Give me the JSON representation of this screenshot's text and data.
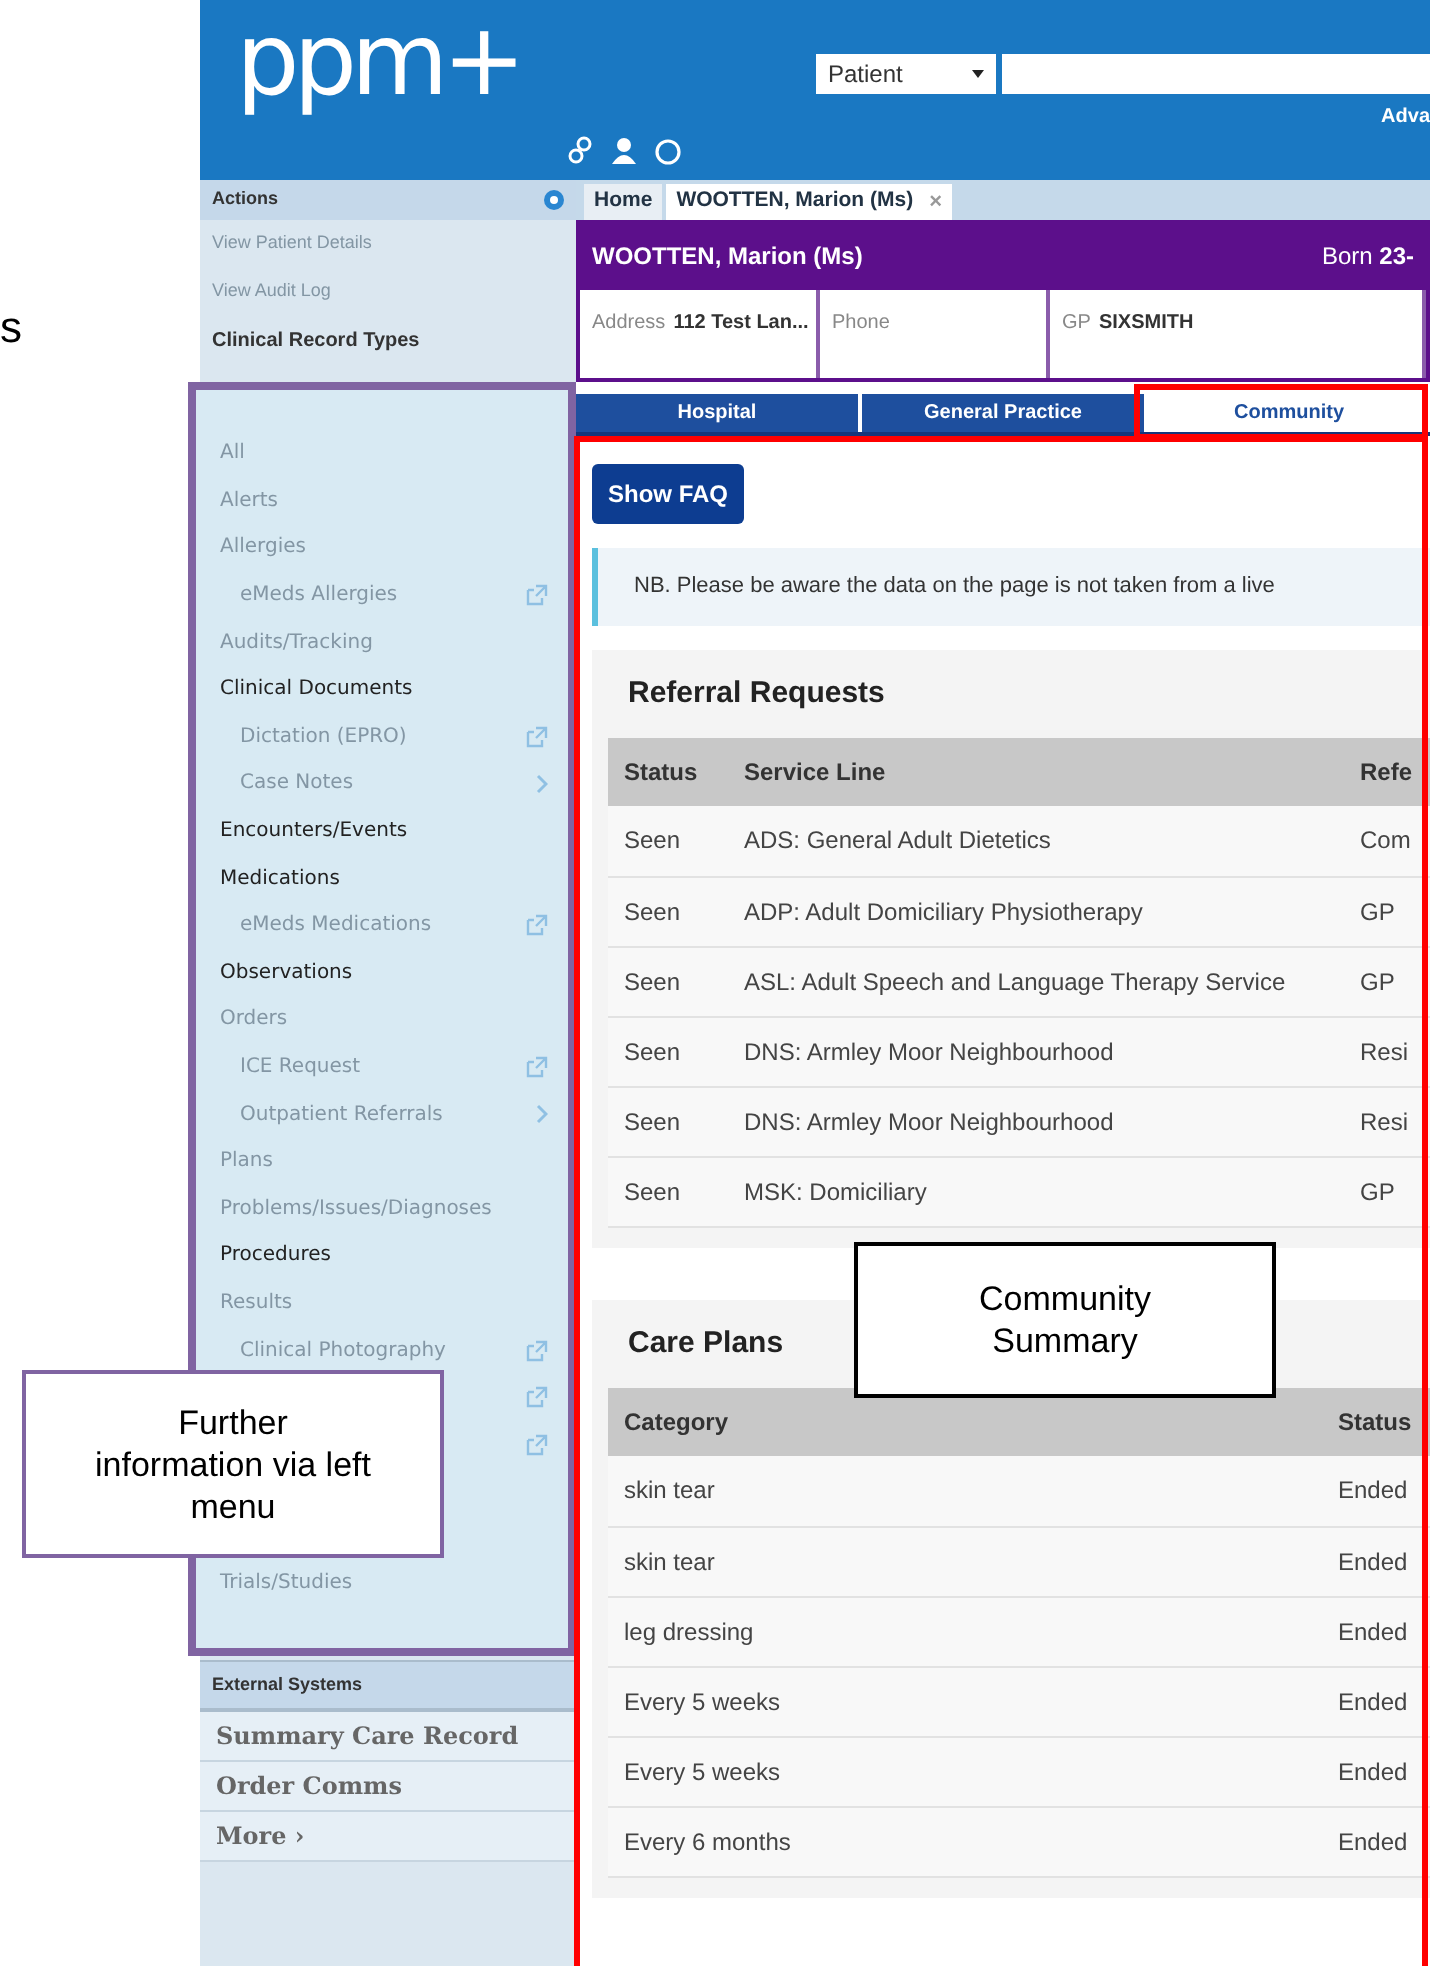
{
  "header": {
    "logo": "ppm+",
    "search_scope": "Patient",
    "advanced_link": "Adva"
  },
  "sidebar": {
    "actions_title": "Actions",
    "actions": [
      {
        "label": "View Patient Details",
        "disabled": true
      },
      {
        "label": "View Audit Log",
        "disabled": true
      }
    ],
    "section_title": "Clinical Record Types",
    "record_types": [
      {
        "label": "All",
        "disabled": true
      },
      {
        "label": "Alerts",
        "disabled": true
      },
      {
        "label": "Allergies",
        "disabled": true,
        "children": [
          {
            "label": "eMeds Allergies",
            "disabled": true,
            "external_link": true
          }
        ]
      },
      {
        "label": "Audits/Tracking",
        "disabled": true
      },
      {
        "label": "Clinical Documents",
        "disabled": false,
        "children": [
          {
            "label": "Dictation (EPRO)",
            "disabled": true,
            "external_link": true
          },
          {
            "label": "Case Notes",
            "disabled": true,
            "submenu": true
          }
        ]
      },
      {
        "label": "Encounters/Events",
        "disabled": false
      },
      {
        "label": "Medications",
        "disabled": false,
        "children": [
          {
            "label": "eMeds Medications",
            "disabled": true,
            "external_link": true
          }
        ]
      },
      {
        "label": "Observations",
        "disabled": false
      },
      {
        "label": "Orders",
        "disabled": true,
        "children": [
          {
            "label": "ICE Request",
            "disabled": true,
            "external_link": true
          },
          {
            "label": "Outpatient Referrals",
            "disabled": true,
            "submenu": true
          }
        ]
      },
      {
        "label": "Plans",
        "disabled": true
      },
      {
        "label": "Problems/Issues/Diagnoses",
        "disabled": true
      },
      {
        "label": "Procedures",
        "disabled": false
      },
      {
        "label": "Results",
        "disabled": true,
        "children": [
          {
            "label": "Clinical Photography",
            "disabled": true,
            "external_link": true
          },
          {
            "external_link": true
          },
          {
            "external_link": true
          }
        ]
      },
      {
        "label": "Trials/Studies",
        "disabled": true
      }
    ],
    "external_title": "External Systems",
    "external": [
      {
        "label": "Summary Care Record"
      },
      {
        "label": "Order Comms"
      },
      {
        "label": "More",
        "suffix": "›"
      }
    ]
  },
  "tabs": [
    {
      "label": "Home",
      "selected": false
    },
    {
      "label": "WOOTTEN, Marion (Ms)",
      "selected": true,
      "close": "×"
    }
  ],
  "banner": {
    "name": "WOOTTEN, Marion (Ms)",
    "born_label": "Born",
    "born_value": "23-"
  },
  "patient_info": [
    {
      "label": "Address",
      "value": "112 Test Lan..."
    },
    {
      "label": "Phone"
    },
    {
      "label": "GP",
      "value": "SIXSMITH"
    }
  ],
  "view_tabs": [
    {
      "label": "Hospital",
      "selected": false
    },
    {
      "label": "General Practice",
      "selected": false
    },
    {
      "label": "Community",
      "selected": true
    }
  ],
  "faq_button": "Show FAQ",
  "notice": "NB. Please be aware the data on the page is not taken from a live",
  "panels": [
    {
      "title": "Referral Requests",
      "columns": [
        "Status",
        "Service Line",
        "Refe"
      ],
      "rows": [
        [
          "Seen",
          "ADS: General Adult Dietetics",
          "Com"
        ],
        [
          "Seen",
          "ADP: Adult Domiciliary Physiotherapy",
          "GP"
        ],
        [
          "Seen",
          "ASL: Adult Speech and Language Therapy Service",
          "GP"
        ],
        [
          "Seen",
          "DNS: Armley Moor Neighbourhood",
          "Resi"
        ],
        [
          "Seen",
          "DNS: Armley Moor Neighbourhood",
          "Resi"
        ],
        [
          "Seen",
          "MSK: Domiciliary",
          "GP"
        ]
      ]
    },
    {
      "title": "Care Plans",
      "columns": [
        "Category",
        "Status"
      ],
      "rows": [
        [
          "skin tear",
          "Ended"
        ],
        [
          "skin tear",
          "Ended"
        ],
        [
          "leg dressing",
          "Ended"
        ],
        [
          "Every 5 weeks",
          "Ended"
        ],
        [
          "Every 5 weeks",
          "Ended"
        ],
        [
          "Every 6 months",
          "Ended"
        ]
      ]
    }
  ],
  "annotations": [
    {
      "kind": "fragment",
      "text": "s"
    },
    {
      "kind": "callout",
      "text": "Further information via left menu",
      "color": "#8064a2"
    },
    {
      "kind": "callout",
      "text": "Community Summary",
      "color": "#000000"
    }
  ]
}
